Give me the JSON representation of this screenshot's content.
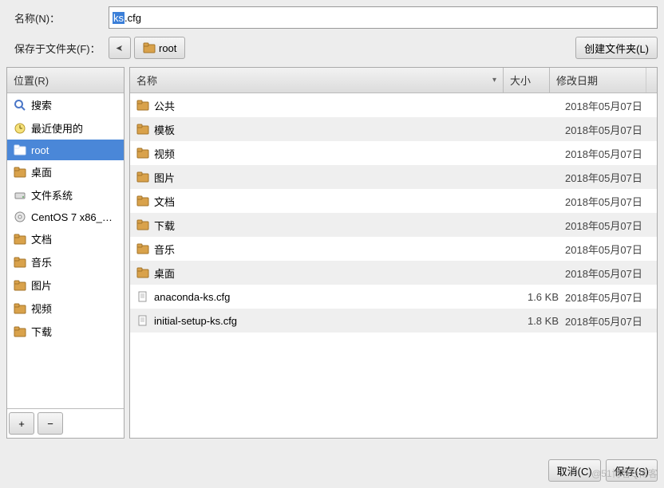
{
  "labels": {
    "name": "名称(N)：",
    "save_in": "保存于文件夹(F)：",
    "create_folder": "创建文件夹(L)",
    "places": "位置(R)",
    "col_name": "名称",
    "col_size": "大小",
    "col_date": "修改日期",
    "cancel": "取消(C)",
    "save": "保存(S)"
  },
  "filename": {
    "selected": "ks",
    "rest": ".cfg"
  },
  "path_current": "root",
  "sidebar": {
    "items": [
      {
        "icon": "search",
        "label": "搜索"
      },
      {
        "icon": "clock",
        "label": "最近使用的"
      },
      {
        "icon": "folder",
        "label": "root",
        "selected": true
      },
      {
        "icon": "folder",
        "label": "桌面"
      },
      {
        "icon": "drive",
        "label": "文件系统"
      },
      {
        "icon": "disc",
        "label": "CentOS 7 x86_…"
      },
      {
        "icon": "folder",
        "label": "文档"
      },
      {
        "icon": "folder",
        "label": "音乐"
      },
      {
        "icon": "folder",
        "label": "图片"
      },
      {
        "icon": "folder",
        "label": "视频"
      },
      {
        "icon": "folder",
        "label": "下载"
      }
    ]
  },
  "files": [
    {
      "icon": "folder",
      "name": "公共",
      "size": "",
      "date": "2018年05月07日"
    },
    {
      "icon": "folder",
      "name": "模板",
      "size": "",
      "date": "2018年05月07日"
    },
    {
      "icon": "folder",
      "name": "视频",
      "size": "",
      "date": "2018年05月07日"
    },
    {
      "icon": "folder",
      "name": "图片",
      "size": "",
      "date": "2018年05月07日"
    },
    {
      "icon": "folder",
      "name": "文档",
      "size": "",
      "date": "2018年05月07日"
    },
    {
      "icon": "folder",
      "name": "下载",
      "size": "",
      "date": "2018年05月07日"
    },
    {
      "icon": "folder",
      "name": "音乐",
      "size": "",
      "date": "2018年05月07日"
    },
    {
      "icon": "folder",
      "name": "桌面",
      "size": "",
      "date": "2018年05月07日"
    },
    {
      "icon": "file",
      "name": "anaconda-ks.cfg",
      "size": "1.6 KB",
      "date": "2018年05月07日"
    },
    {
      "icon": "file",
      "name": "initial-setup-ks.cfg",
      "size": "1.8 KB",
      "date": "2018年05月07日"
    }
  ],
  "watermark": "@51博客Q博客"
}
